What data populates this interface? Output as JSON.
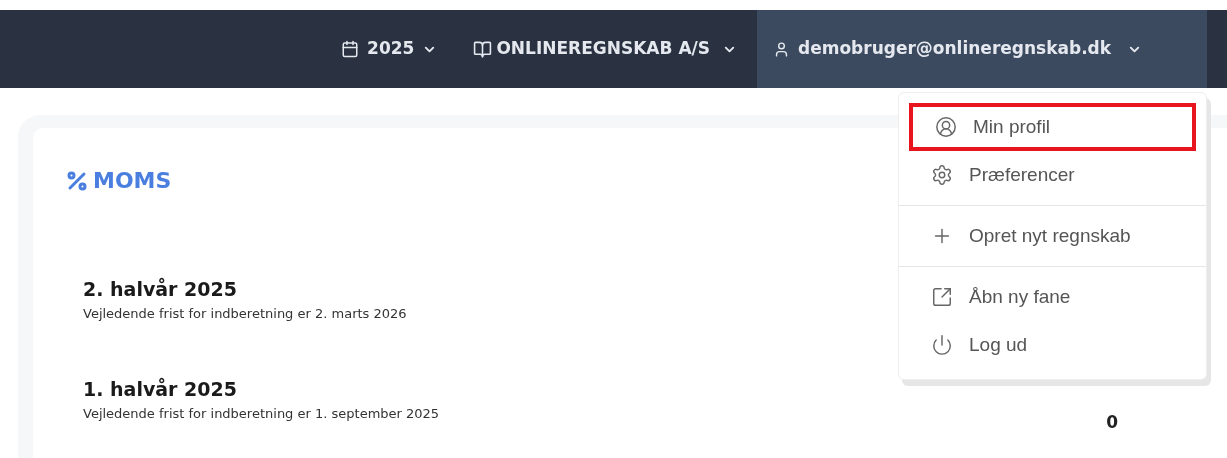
{
  "top_bar": {
    "year": "2025",
    "company": "ONLINEREGNSKAB A/S",
    "user": "demobruger@onlineregnskab.dk",
    "user_menu_expanded": true
  },
  "user_menu": {
    "groups": [
      [
        {
          "label": "Min profil",
          "highlighted": true
        },
        {
          "label": "Præferencer",
          "highlighted": false
        }
      ],
      [
        {
          "label": "Opret nyt regnskab",
          "highlighted": false
        }
      ],
      [
        {
          "label": "Åbn ny fane",
          "highlighted": false
        },
        {
          "label": "Log ud",
          "highlighted": false
        }
      ]
    ]
  },
  "card": {
    "title": "MOMS",
    "periods": [
      {
        "title": "2. halvår 2025",
        "deadline": "Vejledende frist for indberetning er 2. marts 2026"
      },
      {
        "title": "1. halvår 2025",
        "deadline": "Vejledende frist for indberetning er 1. september 2025",
        "amount": "0"
      }
    ]
  }
}
